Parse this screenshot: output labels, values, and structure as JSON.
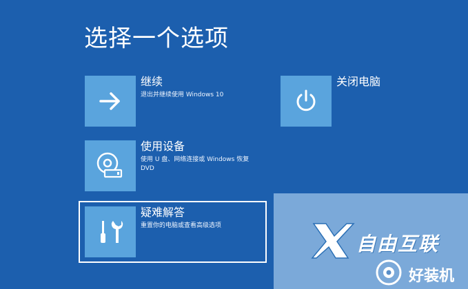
{
  "screen": {
    "title": "选择一个选项"
  },
  "options": {
    "continue": {
      "title": "继续",
      "description": "退出并继续使用 Windows 10",
      "icon": "arrow-right-icon"
    },
    "use_device": {
      "title": "使用设备",
      "description": "使用 U 盘、网络连接或 Windows 恢复 DVD",
      "icon": "disc-drive-icon"
    },
    "troubleshoot": {
      "title": "疑难解答",
      "description": "重置你的电脑或查看高级选项",
      "icon": "tools-icon"
    },
    "shutdown": {
      "title": "关闭电脑",
      "icon": "power-icon"
    }
  },
  "watermark": {
    "brand": "自由互联",
    "sub": "好装机"
  },
  "colors": {
    "background": "#1c5fae",
    "tile": "#5aa4dd",
    "text": "#ffffff"
  }
}
